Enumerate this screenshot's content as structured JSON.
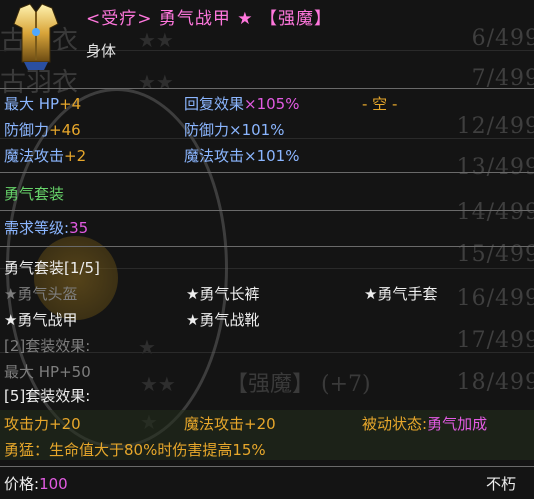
{
  "background": {
    "counts": [
      "6/499",
      "7/499",
      "12/499",
      "13/499",
      "14/499",
      "15/499",
      "16/499",
      "17/499",
      "18/499"
    ],
    "ghost_name": "【强魔】 (+7)"
  },
  "item": {
    "title": "<受疗> 勇气战甲 ★ 【强魔】",
    "type": "身体",
    "icon": "armor-icon"
  },
  "stats": {
    "col1": [
      {
        "label": "最大 HP",
        "value": "+4"
      },
      {
        "label": "防御力",
        "value": "+46"
      },
      {
        "label": "魔法攻击",
        "value": "+2"
      }
    ],
    "col2": [
      {
        "label": "回复效果",
        "value": "×105%"
      },
      {
        "label": "防御力",
        "value": "×101%"
      },
      {
        "label": "魔法攻击",
        "value": "×101%"
      }
    ],
    "slot": "- 空 -"
  },
  "set": {
    "name": "勇气套装",
    "req_label": "需求等级:",
    "req_value": "35",
    "header": "勇气套装[1/5]",
    "pieces": [
      {
        "name": "★勇气头盔",
        "owned": false
      },
      {
        "name": "★勇气长裤",
        "owned": true
      },
      {
        "name": "★勇气手套",
        "owned": true
      },
      {
        "name": "★勇气战甲",
        "owned": true
      },
      {
        "name": "★勇气战靴",
        "owned": true
      }
    ],
    "bonus2_title": "[2]套装效果:",
    "bonus2_line": "最大 HP+50",
    "bonus5_title": "[5]套装效果:",
    "bonus5_a": "攻击力+20",
    "bonus5_b": "魔法攻击+20",
    "bonus5_c_label": "被动状态:",
    "bonus5_c_value": "勇气加成",
    "bonus5_desc": "勇猛：生命值大于80%时伤害提高15%"
  },
  "footer": {
    "price_label": "价格:",
    "price_value": "100",
    "durability": "不朽"
  },
  "colors": {
    "title": "#ff77dd",
    "stat": "#8bb6ff",
    "bonus": "#e7a72b",
    "set_name": "#67d46a",
    "price": "#e25be2"
  }
}
